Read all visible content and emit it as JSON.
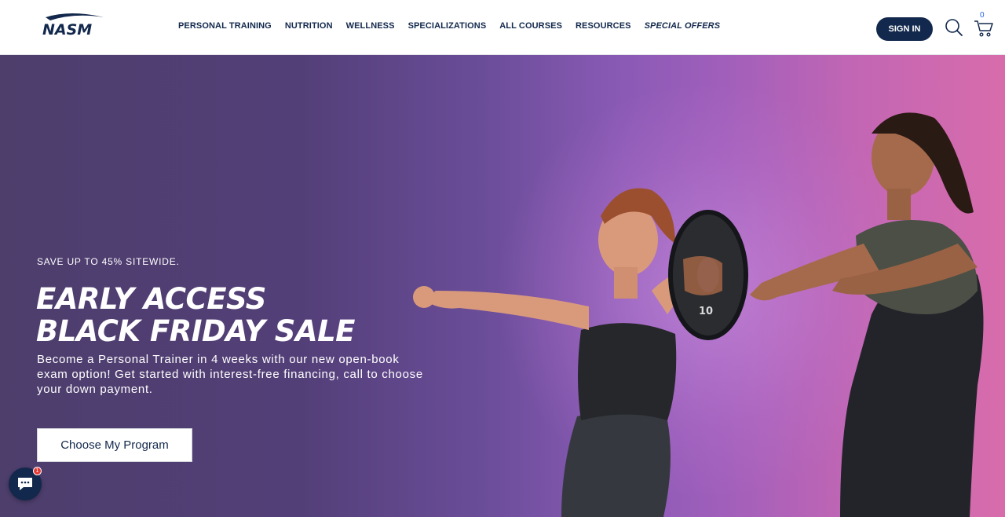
{
  "header": {
    "logo_text": "NASM",
    "nav": [
      {
        "label": "PERSONAL TRAINING"
      },
      {
        "label": "NUTRITION"
      },
      {
        "label": "WELLNESS"
      },
      {
        "label": "SPECIALIZATIONS"
      },
      {
        "label": "ALL COURSES"
      },
      {
        "label": "RESOURCES"
      },
      {
        "label": "SPECIAL OFFERS"
      }
    ],
    "sign_in_label": "SIGN IN",
    "cart_count": "0",
    "icons": {
      "search": "search-icon",
      "cart": "cart-icon"
    }
  },
  "hero": {
    "eyebrow": "SAVE UP TO 45% SITEWIDE.",
    "headline_line1": "EARLY ACCESS",
    "headline_line2": "BLACK FRIDAY SALE",
    "subcopy": "Become a Personal Trainer in 4 weeks with our new open-book exam option! Get started with interest-free financing, call to choose your down payment.",
    "cta_label": "Choose My Program",
    "plate_label": "10"
  },
  "chat": {
    "badge_count": "1",
    "icon": "chat-icon"
  },
  "colors": {
    "brand_navy": "#12284c",
    "hero_purple": "#533f78",
    "hero_pink": "#d86cab",
    "badge_red": "#e53935"
  }
}
